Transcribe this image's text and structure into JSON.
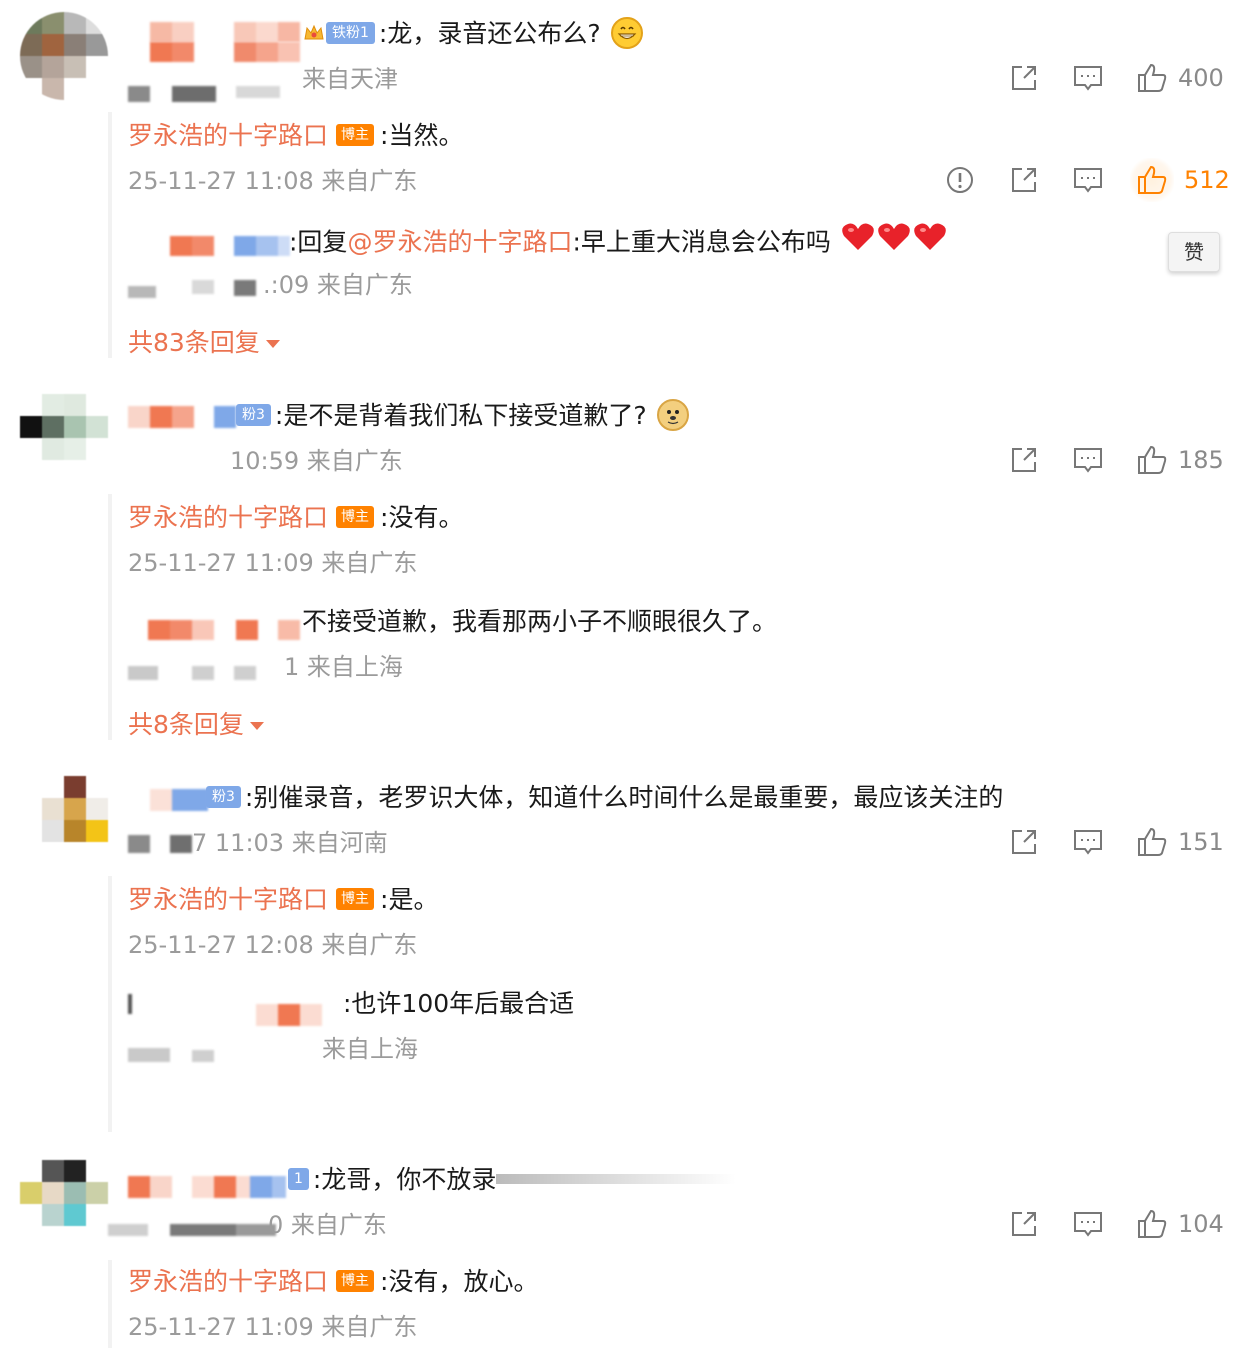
{
  "labels": {
    "host_badge": "博主",
    "reply_prefix": "回复",
    "zan_tooltip": "赞"
  },
  "comments": [
    {
      "badge": "铁粉1",
      "text": ":龙，录音还公布么?",
      "emoji": "grinning-face",
      "meta": "来自天津",
      "likes": "400",
      "host_reply": {
        "author": "罗永浩的十字路口",
        "text": ":当然。",
        "meta": "25-11-27 11:08 来自广东",
        "likes": "512"
      },
      "sub_reply": {
        "prefix": ":回复",
        "mention": "@罗永浩的十字路口",
        "text": ":早上重大消息会公布吗",
        "meta": ".:09 来自广东"
      },
      "more": "共83条回复"
    },
    {
      "badge": "粉3",
      "text": ":是不是背着我们私下接受道歉了?",
      "emoji": "doge",
      "meta": "10:59 来自广东",
      "likes": "185",
      "host_reply": {
        "author": "罗永浩的十字路口",
        "text": ":没有。",
        "meta": "25-11-27 11:09 来自广东"
      },
      "sub_reply": {
        "text": "不接受道歉，我看那两小子不顺眼很久了。",
        "meta": "1 来自上海"
      },
      "more": "共8条回复"
    },
    {
      "badge": "粉3",
      "text": ":别催录音，老罗识大体，知道什么时间什么是最重要，最应该关注的",
      "meta": "7 11:03 来自河南",
      "likes": "151",
      "host_reply": {
        "author": "罗永浩的十字路口",
        "text": ":是。",
        "meta": "25-11-27 12:08 来自广东"
      },
      "sub_reply": {
        "text": ":也许100年后最合适",
        "meta": "来自上海"
      }
    },
    {
      "badge": "1",
      "text": ":龙哥，你不放录",
      "meta": "0 来自广东",
      "likes": "104",
      "host_reply": {
        "author": "罗永浩的十字路口",
        "text": ":没有，放心。",
        "meta": "25-11-27 11:09 来自广东"
      }
    }
  ],
  "icons": {
    "share": "share-icon",
    "comment": "comment-icon",
    "like": "thumbs-up-icon",
    "report": "report-icon"
  },
  "colors": {
    "accent": "#eb7350",
    "host_badge": "#ff8200",
    "fan_badge": "#7fa8e8",
    "meta": "#9b9b9b",
    "like_active": "#ff8200"
  }
}
